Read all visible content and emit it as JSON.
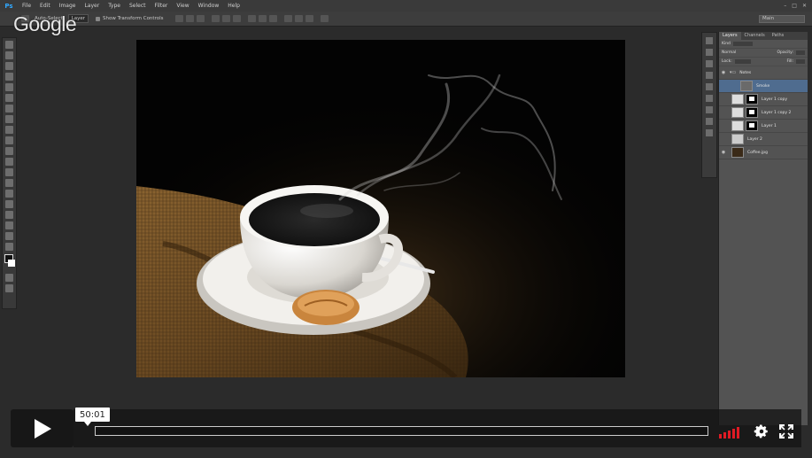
{
  "app": {
    "logo": "Ps",
    "menu": [
      "File",
      "Edit",
      "Image",
      "Layer",
      "Type",
      "Select",
      "Filter",
      "View",
      "Window",
      "Help"
    ],
    "window_controls": [
      "–",
      "□",
      "✕"
    ]
  },
  "options_bar": {
    "auto_select_label": "Auto-Select:",
    "auto_select_value": "Layer",
    "transform_label": "Show Transform Controls",
    "workspace": "Main"
  },
  "watermark": "Google",
  "layers_panel": {
    "tabs": [
      "Layers",
      "Channels",
      "Paths"
    ],
    "filter_label": "Kind",
    "blend_mode": "Normal",
    "opacity_label": "Opacity:",
    "lock_label": "Lock:",
    "fill_label": "Fill:",
    "layers": [
      {
        "name": "Notes",
        "type": "group"
      },
      {
        "name": "Smoke",
        "type": "layer",
        "selected": true
      },
      {
        "name": "Layer 1 copy",
        "type": "masked"
      },
      {
        "name": "Layer 1 copy 2",
        "type": "masked"
      },
      {
        "name": "Layer 1",
        "type": "masked"
      },
      {
        "name": "Layer 2",
        "type": "layer"
      },
      {
        "name": "Coffee.jpg",
        "type": "layer"
      }
    ]
  },
  "player": {
    "timestamp": "50:01",
    "volume_bars": 5,
    "icons": [
      "play-icon",
      "volume-icon",
      "settings-icon",
      "fullscreen-icon"
    ],
    "accent": "#e01b24"
  }
}
